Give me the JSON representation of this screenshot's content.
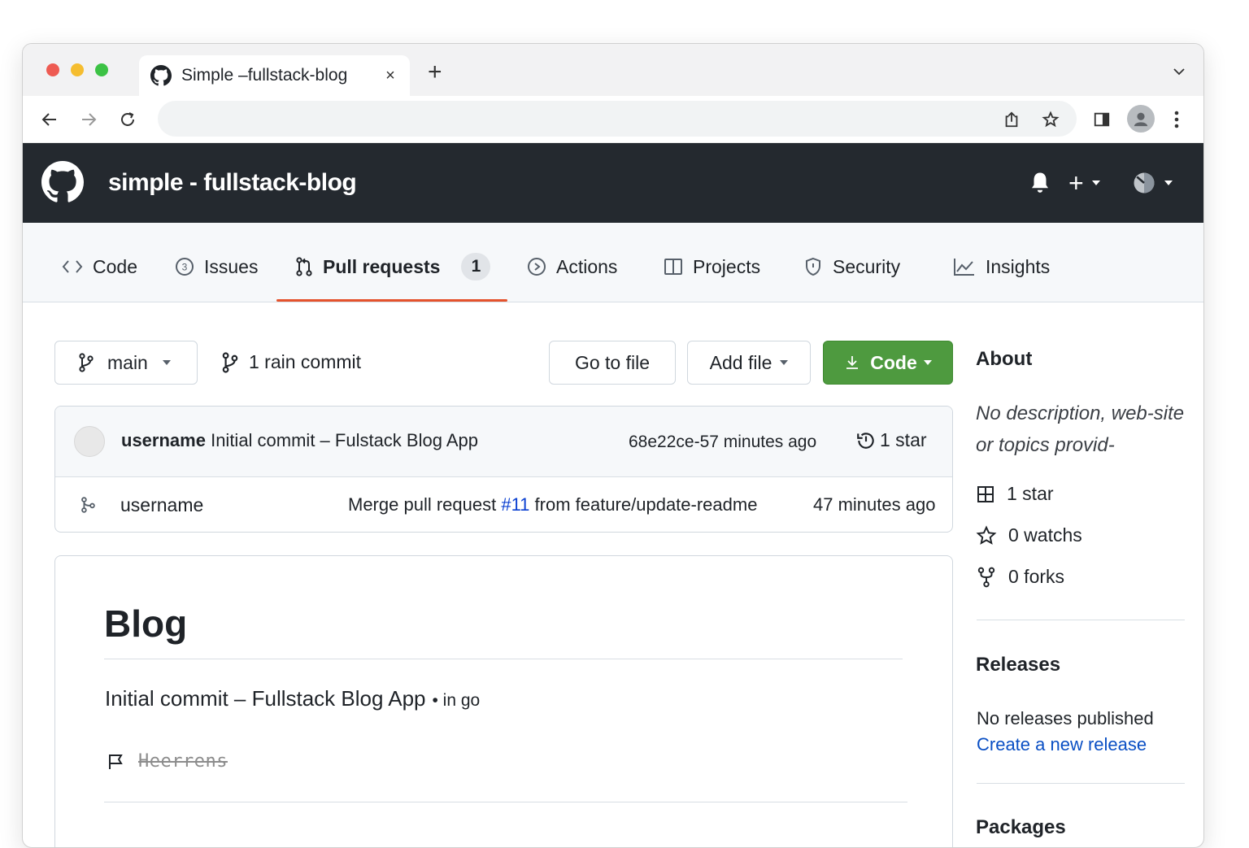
{
  "browser": {
    "tab_title": "Simple –fullstack-blog",
    "new_tab_label": "+",
    "close_label": "×"
  },
  "header": {
    "repo_title": "simple - fullstack-blog",
    "plus_label": "+"
  },
  "nav": {
    "code": "Code",
    "issues": "Issues",
    "pull_requests": "Pull requests",
    "pull_requests_count": "1",
    "actions": "Actions",
    "projects": "Projects",
    "security": "Security",
    "insights": "Insights"
  },
  "toolbar": {
    "branch": "main",
    "commit_count": "1 rain commit",
    "go_to_file": "Go to file",
    "add_file": "Add file",
    "code_button": "Code"
  },
  "latest_commit": {
    "author": "username",
    "message": "Initial commit – Fulstack Blog App",
    "hash_time": "68e22ce-57 minutes ago",
    "stars": "1 star"
  },
  "file_row": {
    "name": "username",
    "message_prefix": "Merge pull request ",
    "pr_link": "#11",
    "message_suffix": " from feature/update-readme",
    "time": "47 minutes ago"
  },
  "readme": {
    "title": "Blog",
    "text": "Initial commit – Fullstack Blog App",
    "meta": "• in go",
    "fuzzy": "Heerrens"
  },
  "sidebar": {
    "about_heading": "About",
    "description": "No description, web-site or topics provid-",
    "stars": "1 star",
    "watchers": "0 watchs",
    "forks": "0 forks",
    "releases_heading": "Releases",
    "releases_text": "No releases published",
    "releases_link": "Create a new release",
    "packages_heading": "Packages"
  },
  "colors": {
    "header_bg": "#24292f",
    "code_button": "#4e9a3f",
    "active_underline": "#e5532d",
    "link": "#0a4fc4"
  }
}
